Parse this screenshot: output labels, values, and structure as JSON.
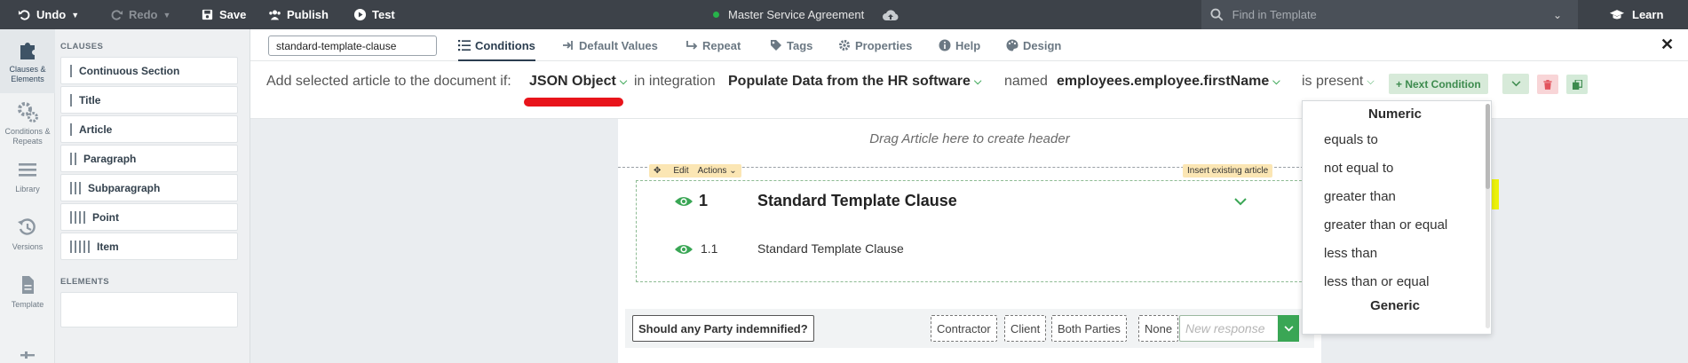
{
  "topbar": {
    "undo": "Undo",
    "redo": "Redo",
    "save": "Save",
    "publish": "Publish",
    "test": "Test",
    "document_title": "Master Service Agreement",
    "find_placeholder": "Find in Template",
    "learn": "Learn",
    "status_color": "#27b34a"
  },
  "rail": {
    "items": [
      {
        "label1": "Clauses &",
        "label2": "Elements",
        "icon": "puzzle-icon"
      },
      {
        "label1": "Conditions &",
        "label2": "Repeats",
        "icon": "gears-icon"
      },
      {
        "label1": "Library",
        "label2": "",
        "icon": "list-icon"
      },
      {
        "label1": "Versions",
        "label2": "",
        "icon": "history-icon"
      },
      {
        "label1": "Template",
        "label2": "",
        "icon": "file-icon"
      }
    ]
  },
  "palette": {
    "clauses_heading": "CLAUSES",
    "elements_heading": "ELEMENTS",
    "items": [
      {
        "label": "Continuous Section",
        "bars": 1
      },
      {
        "label": "Title",
        "bars": 1
      },
      {
        "label": "Article",
        "bars": 1
      },
      {
        "label": "Paragraph",
        "bars": 2
      },
      {
        "label": "Subparagraph",
        "bars": 3
      },
      {
        "label": "Point",
        "bars": 4
      },
      {
        "label": "Item",
        "bars": 5
      }
    ]
  },
  "tabs": {
    "clause_name": "standard-template-clause",
    "items": [
      {
        "label": "Conditions",
        "icon": "list-check-icon"
      },
      {
        "label": "Default Values",
        "icon": "arrow-in-icon"
      },
      {
        "label": "Repeat",
        "icon": "repeat-icon"
      },
      {
        "label": "Tags",
        "icon": "tag-icon"
      },
      {
        "label": "Properties",
        "icon": "gear-icon"
      },
      {
        "label": "Help",
        "icon": "info-icon"
      },
      {
        "label": "Design",
        "icon": "palette-icon"
      }
    ],
    "close": "✕"
  },
  "condition": {
    "prefix": "Add selected article to the document if:",
    "type": "JSON Object",
    "in_integration": "in integration",
    "integration": "Populate Data from the HR software",
    "named": "named",
    "field": "employees.employee.firstName",
    "operator": "is present",
    "next_condition": "+ Next Condition",
    "accent": "#3aa655",
    "danger": "#e8141b"
  },
  "canvas": {
    "drag_hint": "Drag Article here to create header",
    "edit": "Edit",
    "actions": "Actions",
    "insert_existing": "Insert existing article",
    "article_number": "1",
    "article_title": "Standard Template Clause",
    "sub_number": "1.1",
    "sub_title": "Standard Template Clause",
    "question": "Should any Party indemnified?",
    "options": [
      "Contractor",
      "Client",
      "Both Parties",
      "None"
    ],
    "new_response_placeholder": "New response"
  },
  "dropdown": {
    "group1": "Numeric",
    "numeric": [
      "equals to",
      "not equal to",
      "greater than",
      "greater than or equal",
      "less than",
      "less than or equal"
    ],
    "group2": "Generic"
  }
}
